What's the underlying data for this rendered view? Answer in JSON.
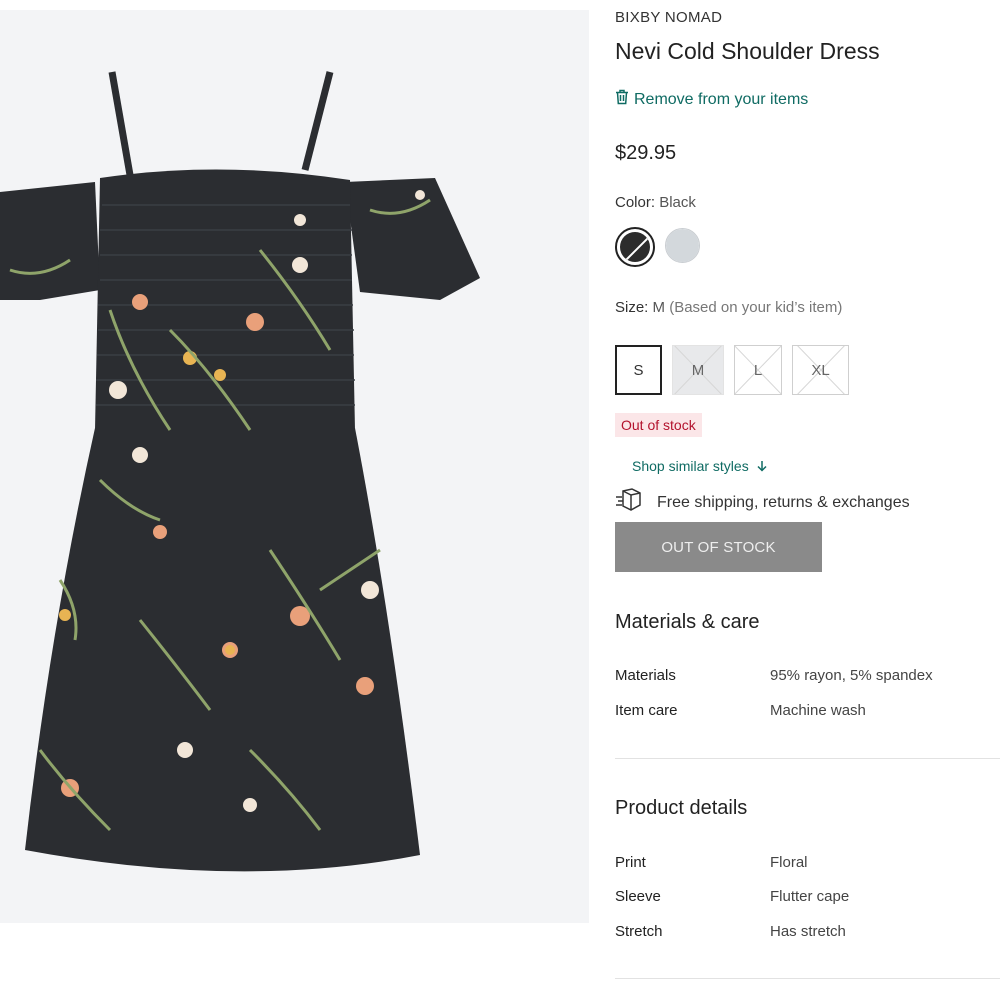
{
  "product": {
    "brand": "BIXBY NOMAD",
    "title": "Nevi Cold Shoulder Dress",
    "remove_label": "Remove from your items",
    "price": "$29.95"
  },
  "color": {
    "label": "Color:",
    "value": "Black",
    "swatches": [
      {
        "name": "Black",
        "hex": "#2c2c2c",
        "selected": true,
        "unavailable": true
      },
      {
        "name": "Grey",
        "hex": "#d3d8dc",
        "selected": false
      }
    ]
  },
  "size": {
    "label": "Size:",
    "value": "M",
    "note": "(Based on your kid’s item)",
    "options": [
      {
        "label": "S",
        "selected": true,
        "unavailable": false
      },
      {
        "label": "M",
        "selected": false,
        "unavailable": true
      },
      {
        "label": "L",
        "selected": false,
        "unavailable": true
      },
      {
        "label": "XL",
        "selected": false,
        "unavailable": true
      }
    ]
  },
  "stock_badge": "Out of stock",
  "similar_link": "Shop similar styles",
  "shipping_text": "Free shipping, returns & exchanges",
  "cta_label": "OUT OF STOCK",
  "materials": {
    "title": "Materials & care",
    "rows": [
      {
        "key": "Materials",
        "value": "95% rayon, 5% spandex"
      },
      {
        "key": "Item care",
        "value": "Machine wash"
      }
    ]
  },
  "details": {
    "title": "Product details",
    "rows": [
      {
        "key": "Print",
        "value": "Floral"
      },
      {
        "key": "Sleeve",
        "value": "Flutter cape"
      },
      {
        "key": "Stretch",
        "value": "Has stretch"
      }
    ]
  },
  "colors": {
    "accent": "#0f6b63",
    "oos_text": "#b3122d",
    "oos_bg": "#fbe6e8",
    "button_disabled": "#8a8a8a",
    "dress": "#2b2d31"
  },
  "icons": {
    "remove": "trash-icon",
    "similar": "arrow-down-icon",
    "shipping": "package-icon"
  }
}
